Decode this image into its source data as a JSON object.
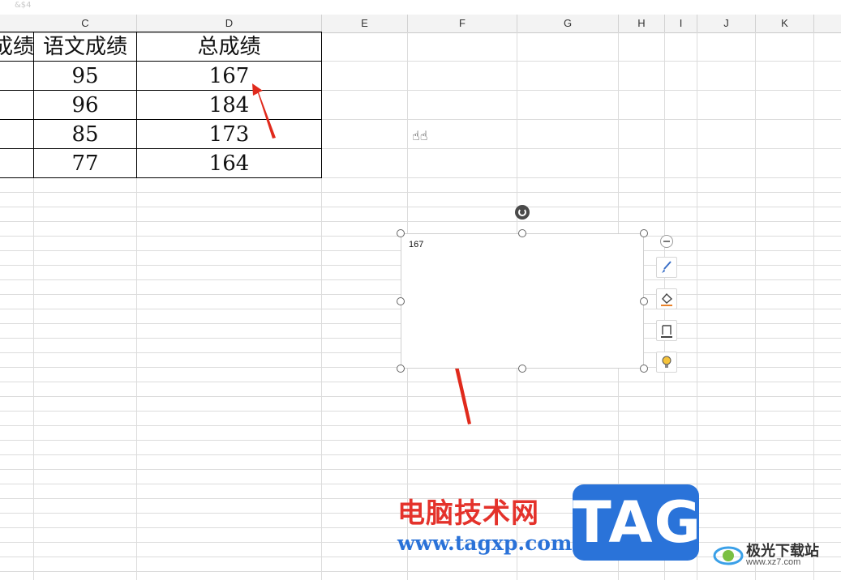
{
  "formula_bar": {
    "text": "&$4"
  },
  "columns": [
    "C",
    "D",
    "E",
    "F",
    "G",
    "H",
    "I",
    "J",
    "K"
  ],
  "table": {
    "headers": [
      "成绩",
      "语文成绩",
      "总成绩"
    ],
    "rows": [
      {
        "chinese": "95",
        "total": "167"
      },
      {
        "chinese": "96",
        "total": "184"
      },
      {
        "chinese": "85",
        "total": "173"
      },
      {
        "chinese": "77",
        "total": "164"
      }
    ]
  },
  "textbox": {
    "content": "167"
  },
  "float_toolbar": {
    "icons": [
      "brush-icon",
      "fill-bucket-icon",
      "outline-icon",
      "bulb-icon"
    ]
  },
  "watermark": {
    "site_name_cn": "电脑技术网",
    "url": "www.tagxp.com",
    "logo_text": "TAG",
    "badge_name": "极光下载站",
    "badge_url": "www.xz7.com"
  },
  "colors": {
    "arrow": "#e02a1c",
    "logo_blue": "#2a73d9",
    "watermark_red": "#e4322b"
  }
}
